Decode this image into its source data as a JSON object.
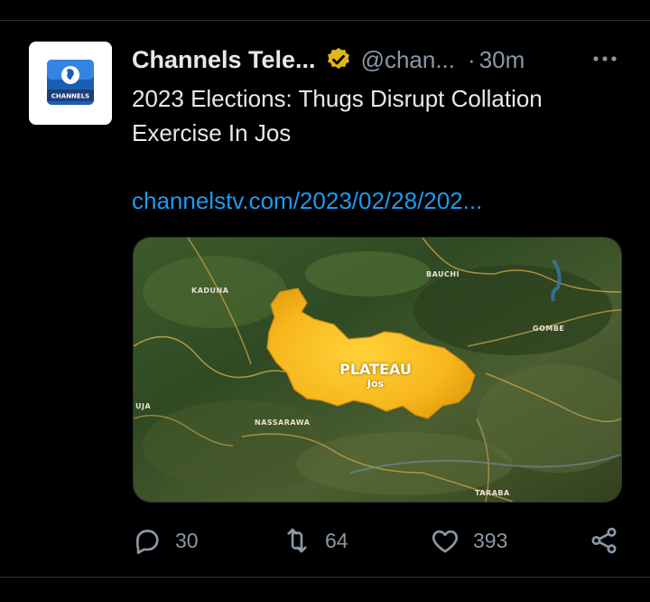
{
  "tweet": {
    "display_name": "Channels Tele...",
    "handle": "@chan...",
    "separator": "·",
    "time": "30m",
    "text": "2023 Elections: Thugs Disrupt Collation Exercise In Jos",
    "link": "channelstv.com/2023/02/28/202...",
    "avatar_text": "CHANNELS"
  },
  "media": {
    "labels": {
      "kaduna": "KADUNA",
      "bauchi": "BAUCHI",
      "gombe": "GOMBE",
      "uja": "UJA",
      "nassarawa": "NASSARAWA",
      "taraba": "TARABA"
    },
    "state": "PLATEAU",
    "city": "Jos"
  },
  "actions": {
    "replies": "30",
    "retweets": "64",
    "likes": "393"
  },
  "colors": {
    "background": "#000000",
    "text": "#e7e9ea",
    "secondary": "#8b98a5",
    "link": "#1d9bf0",
    "verified": "#e2b719",
    "divider": "#2f3336"
  },
  "icons": {
    "verified": "verified-badge-icon",
    "more": "more-icon",
    "reply": "reply-icon",
    "retweet": "retweet-icon",
    "like": "like-icon",
    "share": "share-icon"
  }
}
